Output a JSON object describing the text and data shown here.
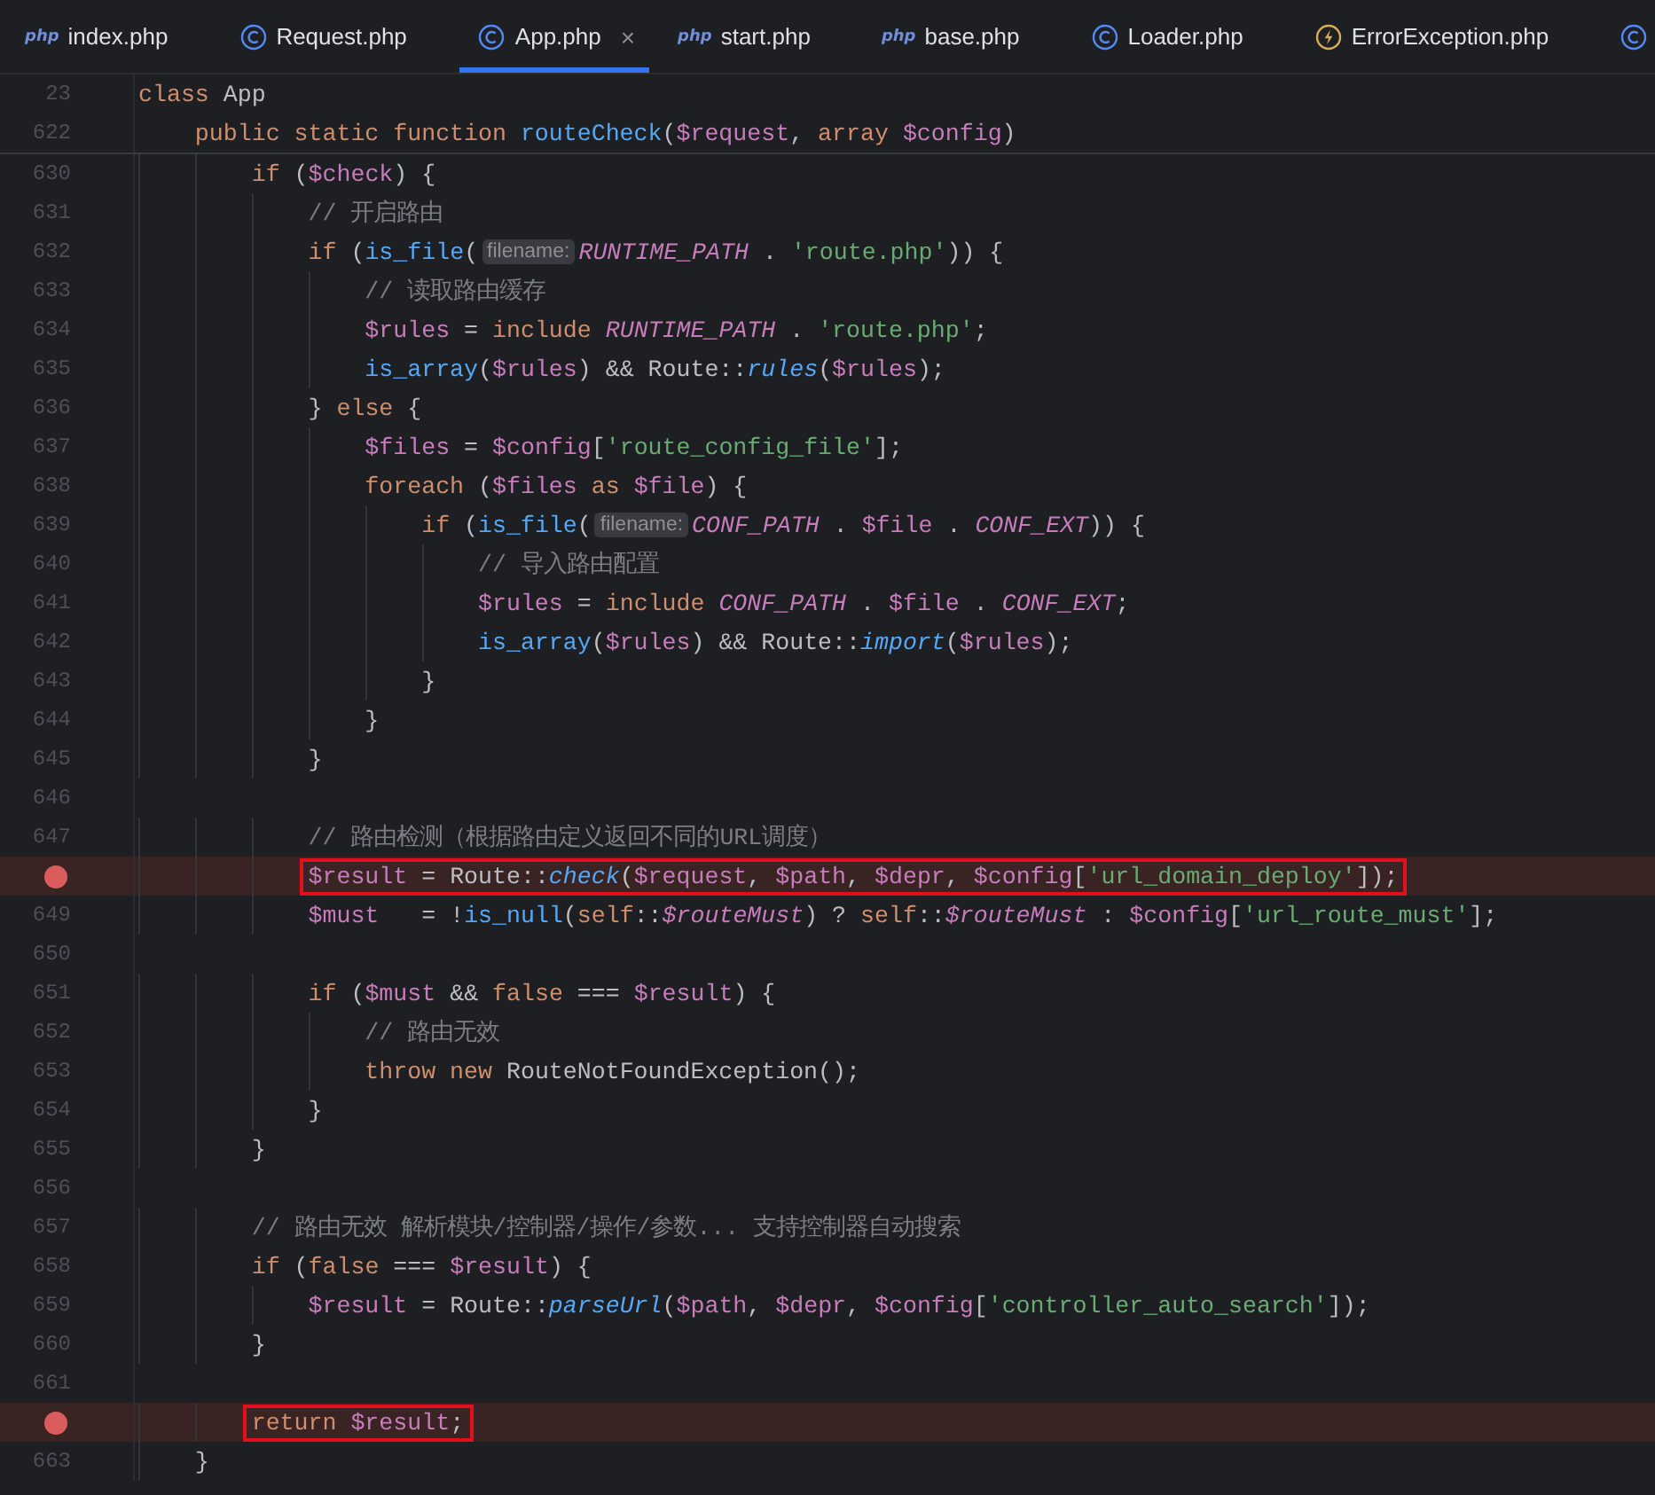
{
  "tabs": [
    {
      "kind": "php",
      "icon_text": "php",
      "label": "index.php",
      "selected": false
    },
    {
      "kind": "class",
      "label": "Request.php",
      "selected": false
    },
    {
      "kind": "class",
      "label": "App.php",
      "selected": true,
      "close": "×"
    },
    {
      "kind": "php",
      "icon_text": "php",
      "label": "start.php",
      "selected": false
    },
    {
      "kind": "php",
      "icon_text": "php",
      "label": "base.php",
      "selected": false
    },
    {
      "kind": "class",
      "label": "Loader.php",
      "selected": false
    },
    {
      "kind": "error",
      "label": "ErrorException.php",
      "selected": false
    },
    {
      "kind": "class",
      "selected": false
    }
  ],
  "header_lines": [
    {
      "number": "23",
      "tokens": [
        {
          "kind": "k",
          "text": "class"
        },
        {
          "kind": "p",
          "text": " App"
        }
      ]
    },
    {
      "number": "622",
      "tokens": [
        {
          "kind": "k",
          "text": "    public static function "
        },
        {
          "kind": "f",
          "text": "routeCheck"
        },
        {
          "kind": "p",
          "text": "("
        },
        {
          "kind": "v",
          "text": "$request"
        },
        {
          "kind": "p",
          "text": ", "
        },
        {
          "kind": "k",
          "text": "array "
        },
        {
          "kind": "v",
          "text": "$config"
        },
        {
          "kind": "p",
          "text": ")"
        }
      ]
    }
  ],
  "lines": [
    {
      "number": "630",
      "breakpoint": false,
      "boxed": false,
      "tokens": [
        {
          "kind": "k",
          "text": "        if"
        },
        {
          "kind": "p",
          "text": " ("
        },
        {
          "kind": "v",
          "text": "$check"
        },
        {
          "kind": "p",
          "text": ") {"
        }
      ]
    },
    {
      "number": "631",
      "breakpoint": false,
      "boxed": false,
      "tokens": [
        {
          "kind": "cm",
          "text": "            // 开启路由"
        }
      ]
    },
    {
      "number": "632",
      "breakpoint": false,
      "boxed": false,
      "tokens": [
        {
          "kind": "k",
          "text": "            if"
        },
        {
          "kind": "p",
          "text": " ("
        },
        {
          "kind": "f",
          "text": "is_file"
        },
        {
          "kind": "p",
          "text": "("
        },
        {
          "kind": "hint",
          "text": "filename:"
        },
        {
          "kind": "c",
          "text": "RUNTIME_PATH"
        },
        {
          "kind": "p",
          "text": " . "
        },
        {
          "kind": "s",
          "text": "'route.php'"
        },
        {
          "kind": "p",
          "text": ")) {"
        }
      ]
    },
    {
      "number": "633",
      "breakpoint": false,
      "boxed": false,
      "tokens": [
        {
          "kind": "cm",
          "text": "                // 读取路由缓存"
        }
      ]
    },
    {
      "number": "634",
      "breakpoint": false,
      "boxed": false,
      "tokens": [
        {
          "kind": "v",
          "text": "                $rules"
        },
        {
          "kind": "p",
          "text": " = "
        },
        {
          "kind": "k",
          "text": "include "
        },
        {
          "kind": "c",
          "text": "RUNTIME_PATH"
        },
        {
          "kind": "p",
          "text": " . "
        },
        {
          "kind": "s",
          "text": "'route.php'"
        },
        {
          "kind": "p",
          "text": ";"
        }
      ]
    },
    {
      "number": "635",
      "breakpoint": false,
      "boxed": false,
      "tokens": [
        {
          "kind": "f",
          "text": "                is_array"
        },
        {
          "kind": "p",
          "text": "("
        },
        {
          "kind": "v",
          "text": "$rules"
        },
        {
          "kind": "p",
          "text": ") && Route::"
        },
        {
          "kind": "fi",
          "text": "rules"
        },
        {
          "kind": "p",
          "text": "("
        },
        {
          "kind": "v",
          "text": "$rules"
        },
        {
          "kind": "p",
          "text": ");"
        }
      ]
    },
    {
      "number": "636",
      "breakpoint": false,
      "boxed": false,
      "tokens": [
        {
          "kind": "p",
          "text": "            } "
        },
        {
          "kind": "k",
          "text": "else"
        },
        {
          "kind": "p",
          "text": " {"
        }
      ]
    },
    {
      "number": "637",
      "breakpoint": false,
      "boxed": false,
      "tokens": [
        {
          "kind": "v",
          "text": "                $files"
        },
        {
          "kind": "p",
          "text": " = "
        },
        {
          "kind": "v",
          "text": "$config"
        },
        {
          "kind": "p",
          "text": "["
        },
        {
          "kind": "s",
          "text": "'route_config_file'"
        },
        {
          "kind": "p",
          "text": "];"
        }
      ]
    },
    {
      "number": "638",
      "breakpoint": false,
      "boxed": false,
      "tokens": [
        {
          "kind": "k",
          "text": "                foreach"
        },
        {
          "kind": "p",
          "text": " ("
        },
        {
          "kind": "v",
          "text": "$files "
        },
        {
          "kind": "k",
          "text": "as "
        },
        {
          "kind": "v",
          "text": "$file"
        },
        {
          "kind": "p",
          "text": ") {"
        }
      ]
    },
    {
      "number": "639",
      "breakpoint": false,
      "boxed": false,
      "tokens": [
        {
          "kind": "k",
          "text": "                    if"
        },
        {
          "kind": "p",
          "text": " ("
        },
        {
          "kind": "f",
          "text": "is_file"
        },
        {
          "kind": "p",
          "text": "("
        },
        {
          "kind": "hint",
          "text": "filename:"
        },
        {
          "kind": "c",
          "text": "CONF_PATH"
        },
        {
          "kind": "p",
          "text": " . "
        },
        {
          "kind": "v",
          "text": "$file"
        },
        {
          "kind": "p",
          "text": " . "
        },
        {
          "kind": "c",
          "text": "CONF_EXT"
        },
        {
          "kind": "p",
          "text": ")) {"
        }
      ]
    },
    {
      "number": "640",
      "breakpoint": false,
      "boxed": false,
      "tokens": [
        {
          "kind": "cm",
          "text": "                        // 导入路由配置"
        }
      ]
    },
    {
      "number": "641",
      "breakpoint": false,
      "boxed": false,
      "tokens": [
        {
          "kind": "v",
          "text": "                        $rules"
        },
        {
          "kind": "p",
          "text": " = "
        },
        {
          "kind": "k",
          "text": "include "
        },
        {
          "kind": "c",
          "text": "CONF_PATH"
        },
        {
          "kind": "p",
          "text": " . "
        },
        {
          "kind": "v",
          "text": "$file"
        },
        {
          "kind": "p",
          "text": " . "
        },
        {
          "kind": "c",
          "text": "CONF_EXT"
        },
        {
          "kind": "p",
          "text": ";"
        }
      ]
    },
    {
      "number": "642",
      "breakpoint": false,
      "boxed": false,
      "tokens": [
        {
          "kind": "f",
          "text": "                        is_array"
        },
        {
          "kind": "p",
          "text": "("
        },
        {
          "kind": "v",
          "text": "$rules"
        },
        {
          "kind": "p",
          "text": ") && Route::"
        },
        {
          "kind": "fi",
          "text": "import"
        },
        {
          "kind": "p",
          "text": "("
        },
        {
          "kind": "v",
          "text": "$rules"
        },
        {
          "kind": "p",
          "text": ");"
        }
      ]
    },
    {
      "number": "643",
      "breakpoint": false,
      "boxed": false,
      "tokens": [
        {
          "kind": "p",
          "text": "                    }"
        }
      ]
    },
    {
      "number": "644",
      "breakpoint": false,
      "boxed": false,
      "tokens": [
        {
          "kind": "p",
          "text": "                }"
        }
      ]
    },
    {
      "number": "645",
      "breakpoint": false,
      "boxed": false,
      "tokens": [
        {
          "kind": "p",
          "text": "            }"
        }
      ]
    },
    {
      "number": "646",
      "breakpoint": false,
      "boxed": false
    },
    {
      "number": "647",
      "breakpoint": false,
      "boxed": false,
      "tokens": [
        {
          "kind": "cm",
          "text": "            // 路由检测（根据路由定义返回不同的URL调度）"
        }
      ]
    },
    {
      "breakpoint": true,
      "boxed": true,
      "tokens": [
        {
          "kind": "v",
          "text": "            $result"
        },
        {
          "kind": "p",
          "text": " = Route::"
        },
        {
          "kind": "fi",
          "text": "check"
        },
        {
          "kind": "p",
          "text": "("
        },
        {
          "kind": "v",
          "text": "$request"
        },
        {
          "kind": "p",
          "text": ", "
        },
        {
          "kind": "v",
          "text": "$path"
        },
        {
          "kind": "p",
          "text": ", "
        },
        {
          "kind": "v",
          "text": "$depr"
        },
        {
          "kind": "p",
          "text": ", "
        },
        {
          "kind": "v",
          "text": "$config"
        },
        {
          "kind": "p",
          "text": "["
        },
        {
          "kind": "s",
          "text": "'url_domain_deploy'"
        },
        {
          "kind": "p",
          "text": "]);"
        }
      ]
    },
    {
      "number": "649",
      "breakpoint": false,
      "boxed": false,
      "tokens": [
        {
          "kind": "v",
          "text": "            $must"
        },
        {
          "kind": "p",
          "text": "   = !"
        },
        {
          "kind": "f",
          "text": "is_null"
        },
        {
          "kind": "p",
          "text": "("
        },
        {
          "kind": "k",
          "text": "self"
        },
        {
          "kind": "p",
          "text": "::"
        },
        {
          "kind": "vi",
          "text": "$routeMust"
        },
        {
          "kind": "p",
          "text": ") ? "
        },
        {
          "kind": "k",
          "text": "self"
        },
        {
          "kind": "p",
          "text": "::"
        },
        {
          "kind": "vi",
          "text": "$routeMust"
        },
        {
          "kind": "p",
          "text": " : "
        },
        {
          "kind": "v",
          "text": "$config"
        },
        {
          "kind": "p",
          "text": "["
        },
        {
          "kind": "s",
          "text": "'url_route_must'"
        },
        {
          "kind": "p",
          "text": "];"
        }
      ]
    },
    {
      "number": "650",
      "breakpoint": false,
      "boxed": false
    },
    {
      "number": "651",
      "breakpoint": false,
      "boxed": false,
      "tokens": [
        {
          "kind": "k",
          "text": "            if"
        },
        {
          "kind": "p",
          "text": " ("
        },
        {
          "kind": "v",
          "text": "$must"
        },
        {
          "kind": "p",
          "text": " && "
        },
        {
          "kind": "k",
          "text": "false"
        },
        {
          "kind": "p",
          "text": " === "
        },
        {
          "kind": "v",
          "text": "$result"
        },
        {
          "kind": "p",
          "text": ") {"
        }
      ]
    },
    {
      "number": "652",
      "breakpoint": false,
      "boxed": false,
      "tokens": [
        {
          "kind": "cm",
          "text": "                // 路由无效"
        }
      ]
    },
    {
      "number": "653",
      "breakpoint": false,
      "boxed": false,
      "tokens": [
        {
          "kind": "k",
          "text": "                throw new"
        },
        {
          "kind": "p",
          "text": " RouteNotFoundException();"
        }
      ]
    },
    {
      "number": "654",
      "breakpoint": false,
      "boxed": false,
      "tokens": [
        {
          "kind": "p",
          "text": "            }"
        }
      ]
    },
    {
      "number": "655",
      "breakpoint": false,
      "boxed": false,
      "tokens": [
        {
          "kind": "p",
          "text": "        }"
        }
      ]
    },
    {
      "number": "656",
      "breakpoint": false,
      "boxed": false
    },
    {
      "number": "657",
      "breakpoint": false,
      "boxed": false,
      "tokens": [
        {
          "kind": "cm",
          "text": "        // 路由无效 解析模块/控制器/操作/参数... 支持控制器自动搜索"
        }
      ]
    },
    {
      "number": "658",
      "breakpoint": false,
      "boxed": false,
      "tokens": [
        {
          "kind": "k",
          "text": "        if"
        },
        {
          "kind": "p",
          "text": " ("
        },
        {
          "kind": "k",
          "text": "false"
        },
        {
          "kind": "p",
          "text": " === "
        },
        {
          "kind": "v",
          "text": "$result"
        },
        {
          "kind": "p",
          "text": ") {"
        }
      ]
    },
    {
      "number": "659",
      "breakpoint": false,
      "boxed": false,
      "tokens": [
        {
          "kind": "v",
          "text": "            $result"
        },
        {
          "kind": "p",
          "text": " = Route::"
        },
        {
          "kind": "fi",
          "text": "parseUrl"
        },
        {
          "kind": "p",
          "text": "("
        },
        {
          "kind": "v",
          "text": "$path"
        },
        {
          "kind": "p",
          "text": ", "
        },
        {
          "kind": "v",
          "text": "$depr"
        },
        {
          "kind": "p",
          "text": ", "
        },
        {
          "kind": "v",
          "text": "$config"
        },
        {
          "kind": "p",
          "text": "["
        },
        {
          "kind": "s",
          "text": "'controller_auto_search'"
        },
        {
          "kind": "p",
          "text": "]);"
        }
      ]
    },
    {
      "number": "660",
      "breakpoint": false,
      "boxed": false,
      "tokens": [
        {
          "kind": "p",
          "text": "        }"
        }
      ]
    },
    {
      "number": "661",
      "breakpoint": false,
      "boxed": false
    },
    {
      "breakpoint": true,
      "boxed": true,
      "tokens": [
        {
          "kind": "k",
          "text": "        return "
        },
        {
          "kind": "v",
          "text": "$result"
        },
        {
          "kind": "p",
          "text": ";"
        }
      ]
    },
    {
      "number": "663",
      "breakpoint": false,
      "boxed": false,
      "tokens": [
        {
          "kind": "p",
          "text": "    }"
        }
      ]
    }
  ]
}
